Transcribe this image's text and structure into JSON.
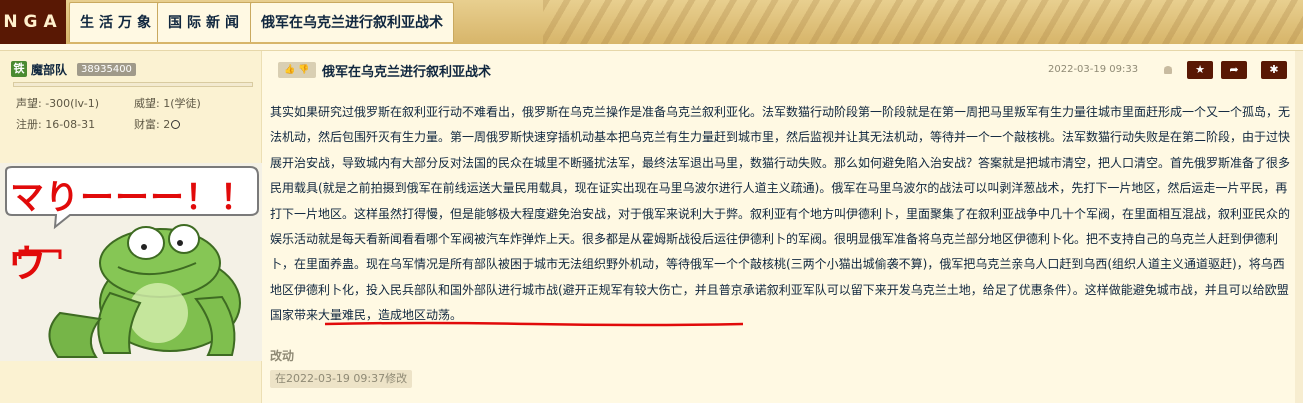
{
  "nav": {
    "logo": "NGA",
    "tabs": [
      {
        "label": "生活万象"
      },
      {
        "label": "国际新闻"
      },
      {
        "label": "俄军在乌克兰进行叙利亚战术"
      }
    ]
  },
  "user": {
    "badge": "铁",
    "name": "魔部队",
    "uid": "38935400",
    "reputation": "声望: -300(lv-1)",
    "prestige": "威望: 1(学徒)",
    "registered": "注册: 16-08-31",
    "wealth": "财富: 2"
  },
  "avatar": {
    "speech": "マりーーー！！",
    "bracket": "ウ"
  },
  "post": {
    "title": "俄军在乌克兰进行叙利亚战术",
    "time": "2022-03-19 09:33",
    "like_icon": "thumbs-up-icon",
    "paragraph_before": "其实如果研究过俄罗斯在叙利亚行动不难看出，俄罗斯在乌克兰操作是准备乌克兰叙利亚化。法军数猫行动阶段第一阶段就是在第一周把马里叛军有生力量往城市里面赶形成一个又一个孤岛，无法机动，然后包围歼灭有生力量。第一周俄罗斯快速穿插机动基本把乌克兰有生力量赶到城市里，然后监视并让其无法机动，等待并一个一个敲核桃。法军数猫行动失败是在第二阶段，由于过快展开治安战，导致城内有大部分反对法国的民众在城里不断骚扰法军，最终法军退出马里，数猫行动失败。那么如何避免陷入治安战？答案就是把城市清空，把人口清空。首先俄罗斯准备了很多民用载具(就是之前拍摄到俄军在前线运送大量民用载具，现在证实出现在马里乌波尔进行人道主义疏通)。俄军在马里乌波尔的战法可以叫剥洋葱战术，先打下一片地区，然后运走一片平民，再打下一片地区。这样虽然打得慢，但是能够极大程度避免治安战，对于俄军来说利大于弊。叙利亚有个地方叫伊德利卜，里面聚集了在叙利亚战争中几十个军阀，在里面相互混战，叙利亚民众的娱乐活动就是每天看新闻看看哪个军阀被汽车炸弹炸上天。很多都是从霍姆斯战役后运往伊德利卜的军阀。很明显俄军准备将乌克兰部分地区伊德利卜化。把不支持自己的乌克兰人赶到伊德利卜，在里面养蛊。现在乌军情况是所有部队被困于城市无法组织野外机动，等待俄军一个个敲核桃(三两个小猫出城偷袭不算)，俄军把乌克兰亲乌人口赶到乌西(组织人道主义通道驱赶)，将乌西地区伊德利卜化，投入民兵部队和国外部队进行城市战(避开正规军有较大伤亡，",
    "paragraph_highlight": "并且普京承诺叙利亚军队可以留下来开发乌克兰土地，给足了优惠条件）",
    "paragraph_after": "。这样做能避免城市战，并且可以给欧盟国家带来大量难民，造成地区动荡。",
    "edit_label": "改动",
    "edit_time": "在2022-03-19 09:37修改"
  },
  "colors": {
    "accent_dark": "#591804",
    "text": "#10273f",
    "background": "#fff9e3",
    "underline": "#e10a0a"
  }
}
